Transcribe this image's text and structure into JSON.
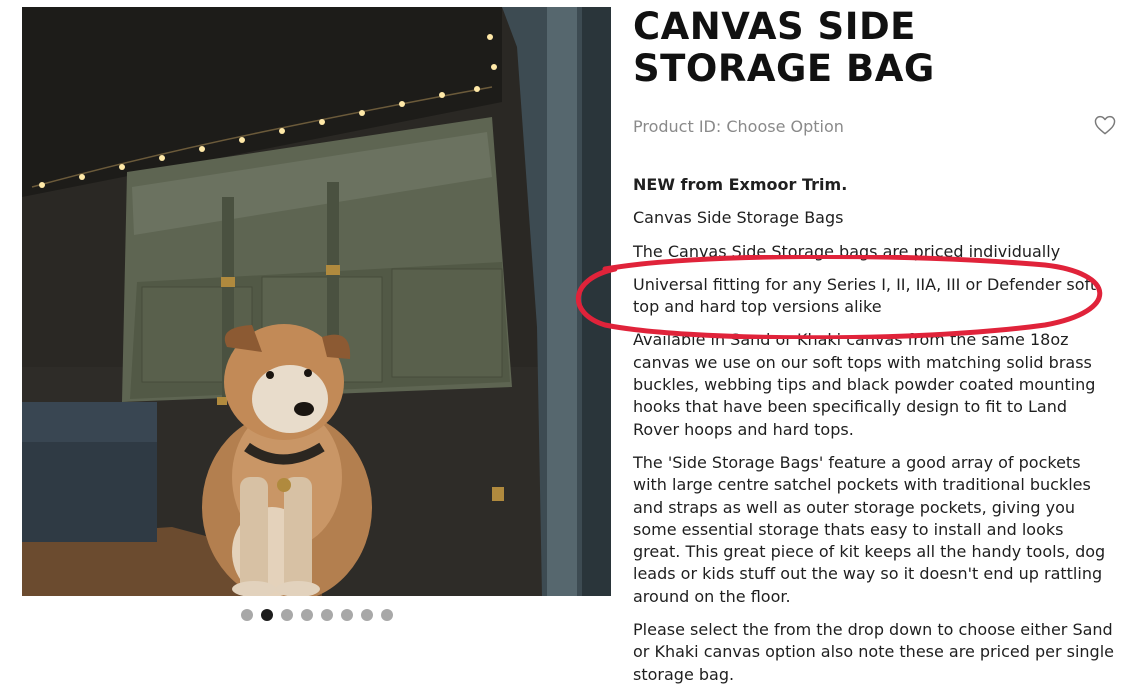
{
  "product": {
    "title": "CANVAS SIDE STORAGE BAG",
    "product_id_label": "Product ID:",
    "product_id_value": "Choose Option",
    "wishlist_icon": "heart-outline-icon"
  },
  "gallery": {
    "image_subject": "dog-in-van-photo",
    "total_slides": 8,
    "active_slide": 2
  },
  "description": {
    "intro_bold": "NEW from Exmoor Trim.",
    "line1": "Canvas Side Storage Bags",
    "line2": "The Canvas Side Storage bags are priced individually",
    "line3": "Universal fitting for any Series I, II, IIA, III or Defender soft top and hard top versions alike",
    "para1": "Available in Sand or Khaki canvas from the same 18oz canvas we use on our soft tops with matching solid brass buckles, webbing tips and black powder coated mounting hooks that have been specifically design to fit to Land Rover hoops and hard tops.",
    "para2": "The 'Side Storage Bags' feature a good array of pockets with large centre satchel pockets with traditional buckles and straps as well as outer storage pockets, giving you some essential storage thats easy to install and looks great. This great piece of kit keeps all the handy tools, dog leads or kids stuff out the way so it doesn't end up rattling around on the floor.",
    "para3": "Please select the from the drop down to choose either Sand or Khaki canvas option also note these are priced per single storage bag."
  },
  "colors": {
    "annotation_ring": "#e0233a",
    "active_dot": "#1c1c1c",
    "inactive_dot": "#a8a8a8"
  }
}
